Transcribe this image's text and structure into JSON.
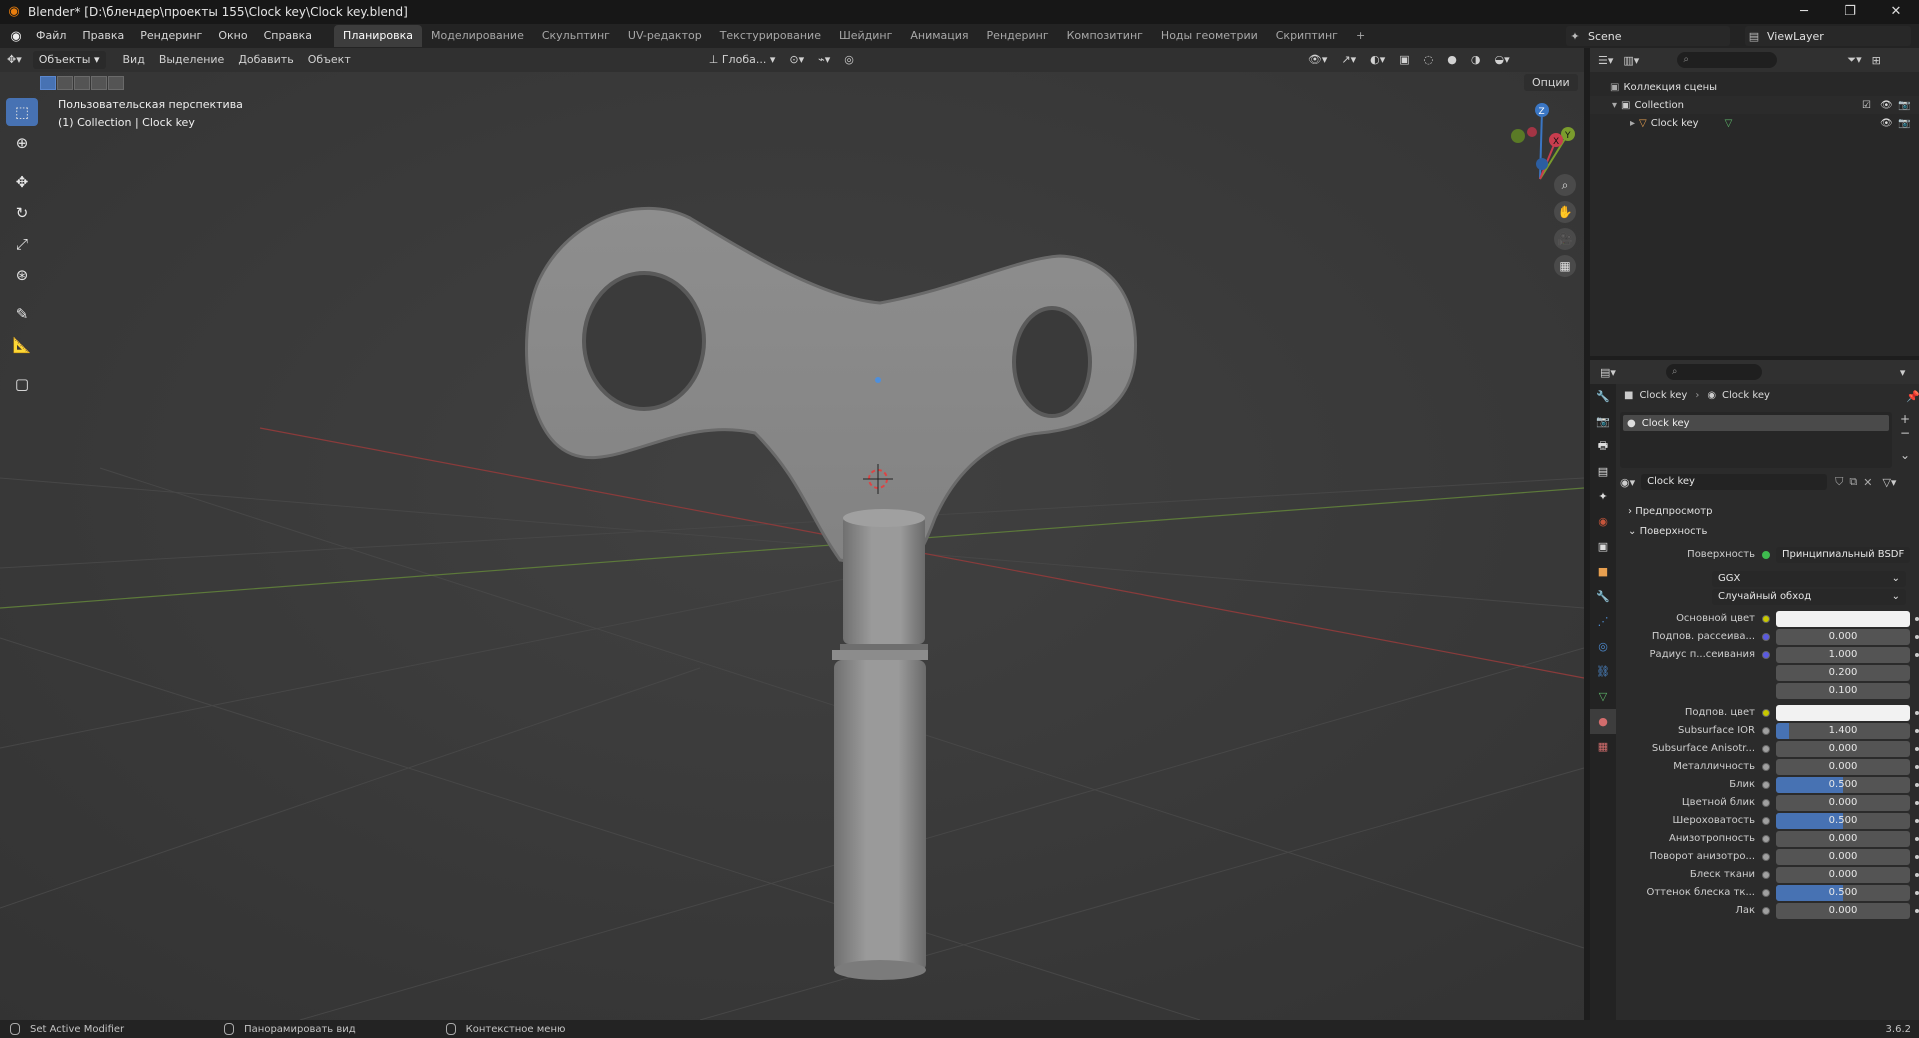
{
  "window": {
    "title": "Blender* [D:\\блендер\\проекты 155\\Clock key\\Clock key.blend]",
    "controls": [
      "─",
      "❐",
      "✕"
    ]
  },
  "menu": [
    "Файл",
    "Правка",
    "Рендеринг",
    "Окно",
    "Справка"
  ],
  "workspaces": {
    "tabs": [
      "Планировка",
      "Моделирование",
      "Скульптинг",
      "UV-редактор",
      "Текстурирование",
      "Шейдинг",
      "Анимация",
      "Рендеринг",
      "Композитинг",
      "Ноды геометрии",
      "Скриптинг"
    ],
    "active_index": 0,
    "add_label": "+"
  },
  "scene": {
    "name": "Scene"
  },
  "view_layer": {
    "name": "ViewLayer"
  },
  "viewport": {
    "mode": "Объекты",
    "menus": [
      "Вид",
      "Выделение",
      "Добавить",
      "Объект"
    ],
    "orientation": "Глоба...",
    "overlay_title": "Пользовательская перспектива",
    "overlay_subtitle": "(1) Collection | Clock key",
    "options_label": "Опции",
    "gizmo": {
      "x": "X",
      "y": "Y",
      "z": "Z"
    }
  },
  "outliner": {
    "search_placeholder": "⌕",
    "root": "Коллекция сцены",
    "collection": "Collection",
    "object": "Clock key"
  },
  "properties": {
    "search_placeholder": "⌕",
    "breadcrumb_object": "Clock key",
    "breadcrumb_material": "Clock key",
    "slot_name": "Clock key",
    "material_name": "Clock key",
    "sections": {
      "preview": "Предпросмотр",
      "surface": "Поверхность"
    },
    "surface_label": "Поверхность",
    "surface_value": "Принципиальный BSDF",
    "distribution": "GGX",
    "subsurface_method": "Случайный обход",
    "rows": [
      {
        "label": "Основной цвет",
        "value": "",
        "type": "color",
        "dot": "yellow"
      },
      {
        "label": "Подпов. рассеива...",
        "value": "0.000",
        "fill": 0,
        "dot": "blue"
      },
      {
        "label": "Радиус п...сеивания",
        "value": "1.000",
        "fill": 0,
        "dot": "blue"
      },
      {
        "label": "",
        "value": "0.200",
        "fill": 0,
        "dot": ""
      },
      {
        "label": "",
        "value": "0.100",
        "fill": 0,
        "dot": ""
      },
      {
        "label": "Подпов. цвет",
        "value": "",
        "type": "color",
        "dot": "yellow"
      },
      {
        "label": "Subsurface IOR",
        "value": "1.400",
        "fill": 0.1,
        "dot": "grey"
      },
      {
        "label": "Subsurface Anisotr...",
        "value": "0.000",
        "fill": 0,
        "dot": "grey"
      },
      {
        "label": "Металличность",
        "value": "0.000",
        "fill": 0,
        "dot": "grey"
      },
      {
        "label": "Блик",
        "value": "0.500",
        "fill": 0.5,
        "dot": "grey"
      },
      {
        "label": "Цветной блик",
        "value": "0.000",
        "fill": 0,
        "dot": "grey"
      },
      {
        "label": "Шероховатость",
        "value": "0.500",
        "fill": 0.5,
        "dot": "grey"
      },
      {
        "label": "Анизотропность",
        "value": "0.000",
        "fill": 0,
        "dot": "grey"
      },
      {
        "label": "Поворот анизотро...",
        "value": "0.000",
        "fill": 0,
        "dot": "grey"
      },
      {
        "label": "Блеск ткани",
        "value": "0.000",
        "fill": 0,
        "dot": "grey"
      },
      {
        "label": "Оттенок блеска тк...",
        "value": "0.500",
        "fill": 0.5,
        "dot": "grey"
      },
      {
        "label": "Лак",
        "value": "0.000",
        "fill": 0,
        "dot": "grey"
      }
    ]
  },
  "statusbar": {
    "items": [
      "Set Active Modifier",
      "Панорамировать вид",
      "Контекстное меню"
    ],
    "version": "3.6.2"
  }
}
